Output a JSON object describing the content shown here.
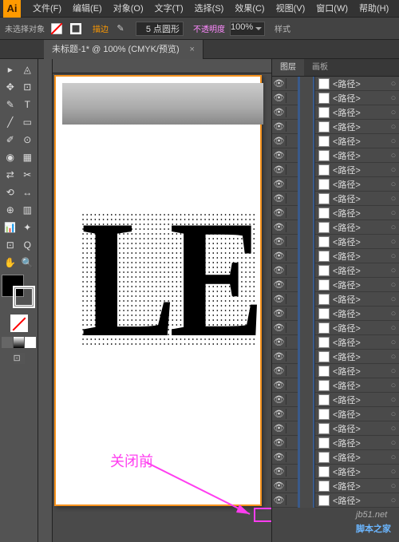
{
  "menubar": {
    "items": [
      "文件(F)",
      "编辑(E)",
      "对象(O)",
      "文字(T)",
      "选择(S)",
      "效果(C)",
      "视图(V)",
      "窗口(W)",
      "帮助(H)"
    ]
  },
  "controlbar": {
    "selection": "未选择对象",
    "stroke_label": "描边",
    "stroke_value": "5 点圆形",
    "opacity_label": "不透明度",
    "opacity_value": "100%",
    "style_label": "样式"
  },
  "document_tab": {
    "title": "未标题-1* @ 100% (CMYK/预览)",
    "close": "×"
  },
  "tools": [
    [
      "▸",
      "◬"
    ],
    [
      "✥",
      "⊡"
    ],
    [
      "✎",
      "T"
    ],
    [
      "╱",
      "▭"
    ],
    [
      "✐",
      "⊙"
    ],
    [
      "◉",
      "▦"
    ],
    [
      "⇄",
      "✂"
    ],
    [
      "⟲",
      "↔"
    ],
    [
      "⊕",
      "▥"
    ],
    [
      "📊",
      "✦"
    ],
    [
      "⊡",
      "Q"
    ],
    [
      "✋",
      "🔍"
    ]
  ],
  "mode_buttons": [
    "□",
    "■",
    "■"
  ],
  "panels": {
    "tabs": [
      "图层",
      "画板"
    ],
    "active_tab": 0,
    "layer_name": "<路径>",
    "sublayer_name": "<路径>",
    "item_count": 30
  },
  "canvas_text": "LE",
  "annotation_text": "关闭前",
  "watermark": {
    "site": "脚本之家",
    "url": "jb51.net"
  }
}
